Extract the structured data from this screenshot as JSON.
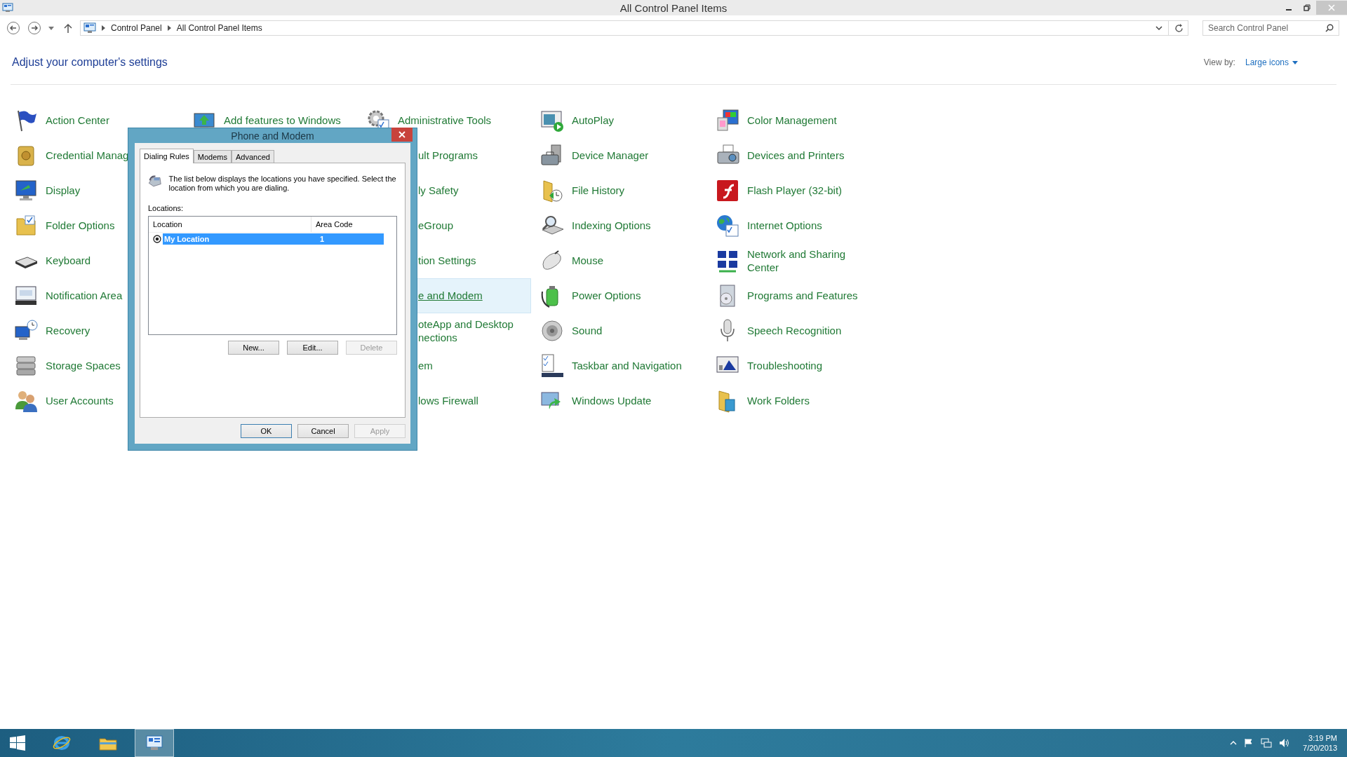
{
  "window": {
    "title": "All Control Panel Items"
  },
  "address": {
    "crumbs": [
      "Control Panel",
      "All Control Panel Items"
    ]
  },
  "search": {
    "placeholder": "Search Control Panel"
  },
  "heading": "Adjust your computer's settings",
  "view_by": {
    "label": "View by:",
    "value": "Large icons"
  },
  "columns": [
    [
      {
        "label": "Action Center",
        "kind": "item",
        "selected": false
      },
      {
        "label": "Credential Manag",
        "kind": "item",
        "selected": false
      },
      {
        "label": "Display",
        "kind": "item",
        "selected": false
      },
      {
        "label": "Folder Options",
        "kind": "item",
        "selected": false
      },
      {
        "label": "Keyboard",
        "kind": "item",
        "selected": false
      },
      {
        "label": "Notification Area",
        "kind": "item",
        "selected": false
      },
      {
        "label": "Recovery",
        "kind": "item",
        "selected": false
      },
      {
        "label": "Storage Spaces",
        "kind": "item",
        "selected": false
      },
      {
        "label": "User Accounts",
        "kind": "item",
        "selected": false
      }
    ],
    [
      {
        "label": "Add features to Windows",
        "kind": "item",
        "selected": false
      }
    ],
    [
      {
        "label": "Administrative Tools",
        "kind": "item",
        "selected": false
      },
      {
        "label": "ult Programs",
        "kind": "cut",
        "selected": false
      },
      {
        "label": "ly Safety",
        "kind": "cut",
        "selected": false
      },
      {
        "label": "eGroup",
        "kind": "cut",
        "selected": false
      },
      {
        "label": "tion Settings",
        "kind": "cut",
        "selected": false
      },
      {
        "label": "e and Modem",
        "kind": "cut",
        "selected": true
      },
      {
        "label": "oteApp and Desktop nections",
        "kind": "cut",
        "selected": false
      },
      {
        "label": "em",
        "kind": "cut",
        "selected": false
      },
      {
        "label": "lows Firewall",
        "kind": "cut",
        "selected": false
      }
    ],
    [
      {
        "label": "AutoPlay",
        "kind": "item",
        "selected": false
      },
      {
        "label": "Device Manager",
        "kind": "item",
        "selected": false
      },
      {
        "label": "File History",
        "kind": "item",
        "selected": false
      },
      {
        "label": "Indexing Options",
        "kind": "item",
        "selected": false
      },
      {
        "label": "Mouse",
        "kind": "item",
        "selected": false
      },
      {
        "label": "Power Options",
        "kind": "item",
        "selected": false
      },
      {
        "label": "Sound",
        "kind": "item",
        "selected": false
      },
      {
        "label": "Taskbar and Navigation",
        "kind": "item",
        "selected": false
      },
      {
        "label": "Windows Update",
        "kind": "item",
        "selected": false
      }
    ],
    [
      {
        "label": "Color Management",
        "kind": "item",
        "selected": false
      },
      {
        "label": "Devices and Printers",
        "kind": "item",
        "selected": false
      },
      {
        "label": "Flash Player (32-bit)",
        "kind": "item",
        "selected": false
      },
      {
        "label": "Internet Options",
        "kind": "item",
        "selected": false
      },
      {
        "label": "Network and Sharing Center",
        "kind": "item",
        "selected": false
      },
      {
        "label": "Programs and Features",
        "kind": "item",
        "selected": false
      },
      {
        "label": "Speech Recognition",
        "kind": "item",
        "selected": false
      },
      {
        "label": "Troubleshooting",
        "kind": "item",
        "selected": false
      },
      {
        "label": "Work Folders",
        "kind": "item",
        "selected": false
      }
    ]
  ],
  "dialog": {
    "title": "Phone and Modem",
    "tabs": [
      {
        "label": "Dialing Rules",
        "selected": true
      },
      {
        "label": "Modems",
        "selected": false
      },
      {
        "label": "Advanced",
        "selected": false
      }
    ],
    "intro": "The list below displays the locations you have specified. Select the location from which you are dialing.",
    "list_label": "Locations:",
    "columns": [
      "Location",
      "Area Code"
    ],
    "rows": [
      {
        "location": "My Location",
        "area_code": "1",
        "selected": true,
        "default": true
      }
    ],
    "list_buttons": [
      {
        "label": "New...",
        "disabled": false
      },
      {
        "label": "Edit...",
        "disabled": false
      },
      {
        "label": "Delete",
        "disabled": true
      }
    ],
    "buttons": [
      {
        "label": "OK",
        "default": true,
        "disabled": false
      },
      {
        "label": "Cancel",
        "default": false,
        "disabled": false
      },
      {
        "label": "Apply",
        "default": false,
        "disabled": true
      }
    ]
  },
  "taskbar": {
    "apps": [
      {
        "selected": false
      },
      {
        "selected": false
      },
      {
        "selected": true
      }
    ]
  },
  "clock": {
    "time": "3:19 PM",
    "date": "7/20/2013"
  }
}
